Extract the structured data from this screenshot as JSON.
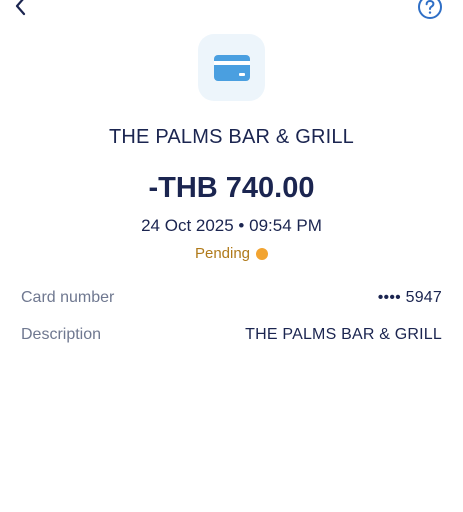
{
  "header": {
    "back_icon": "chevron-left-icon",
    "help_icon": "question-circle-icon",
    "accent": "#2f6fc6"
  },
  "merchant": {
    "icon": "credit-card-icon",
    "name": "THE PALMS BAR & GRILL"
  },
  "transaction": {
    "amount": "-THB 740.00",
    "datetime": "24 Oct 2025 • 09:54 PM",
    "status": "Pending",
    "status_color": "#f2a431"
  },
  "details": {
    "card_number_label": "Card number",
    "card_number_value": "•••• 5947",
    "description_label": "Description",
    "description_value": "THE PALMS BAR & GRILL"
  }
}
